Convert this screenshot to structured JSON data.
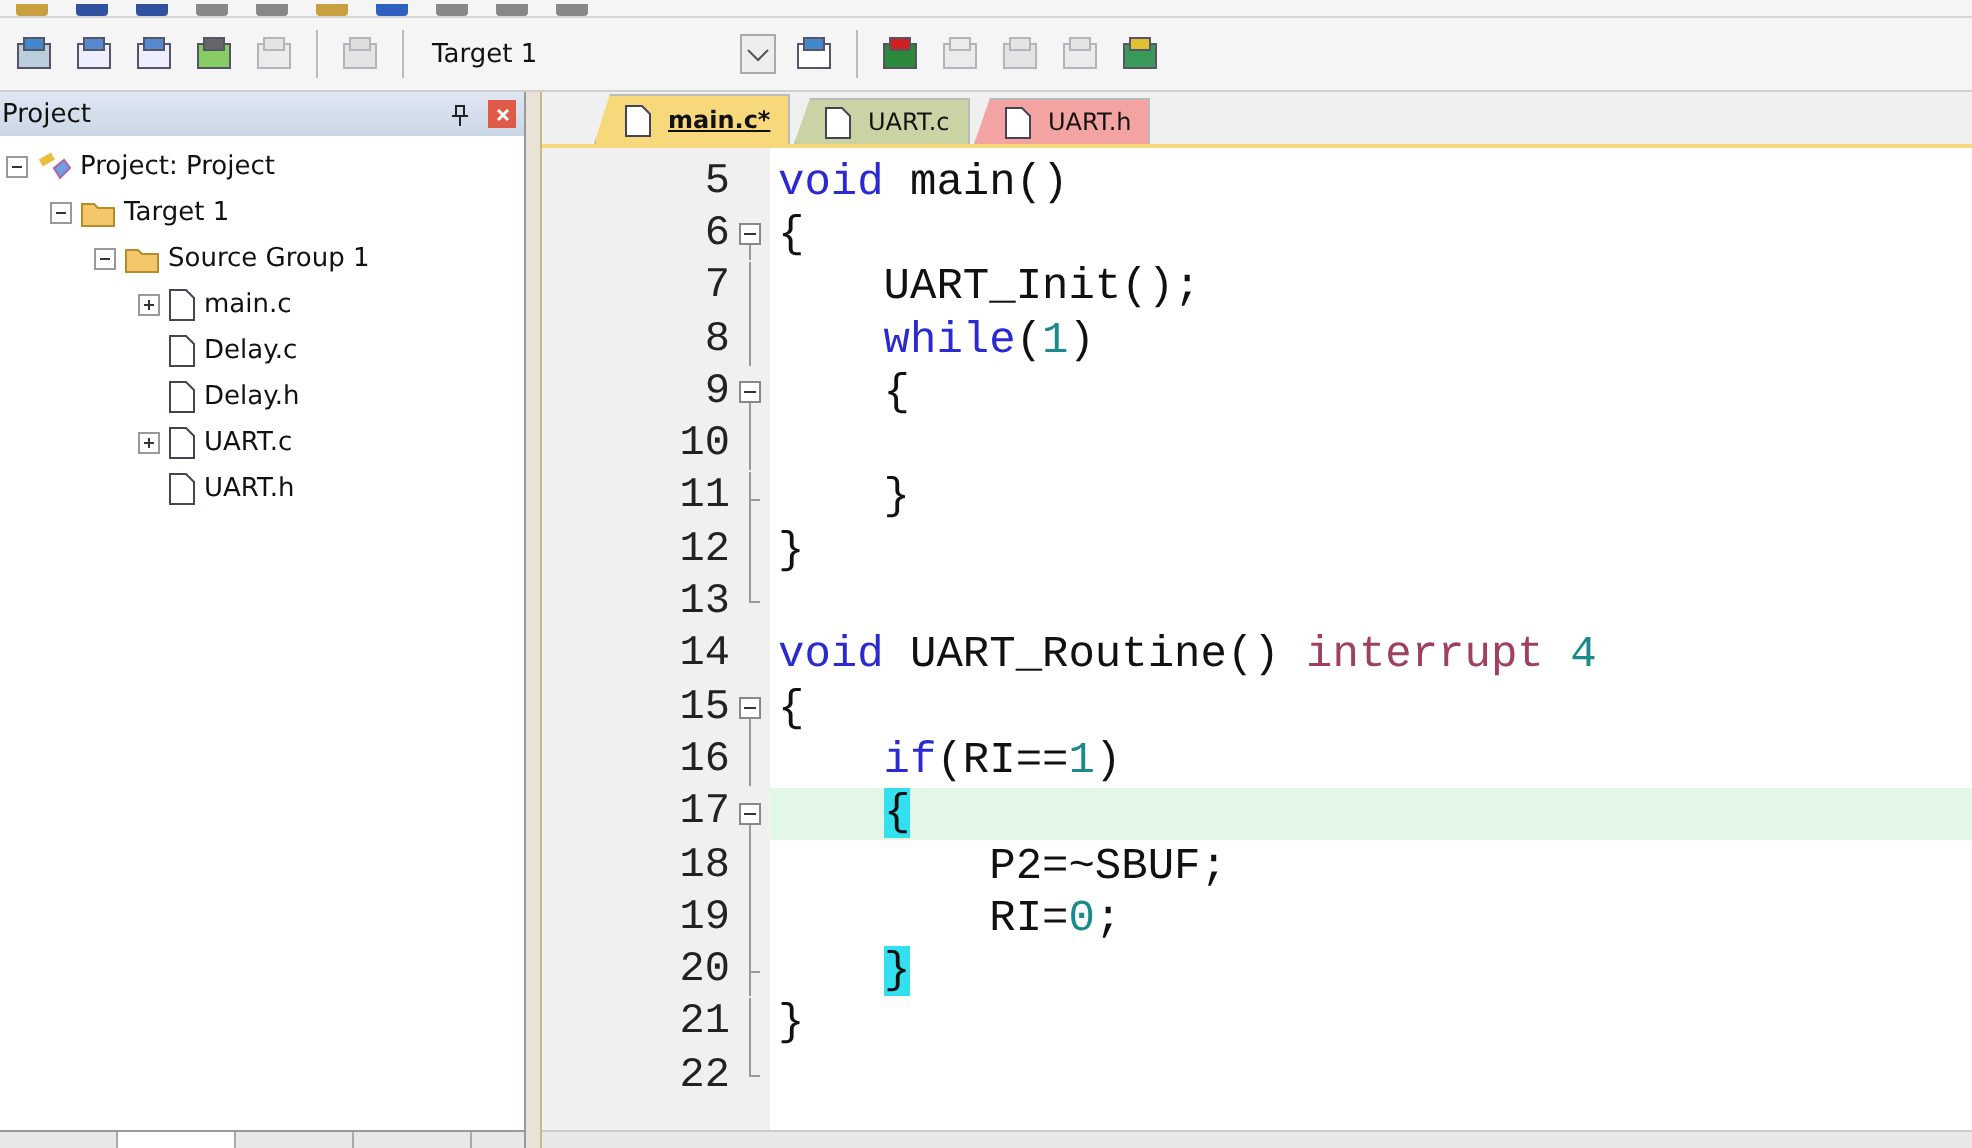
{
  "toolbar": {
    "target": "Target 1"
  },
  "project_panel": {
    "title": "Project",
    "tree": [
      {
        "label": "Project: Project",
        "kind": "project",
        "expanded": true,
        "children": [
          {
            "label": "Target 1",
            "kind": "target",
            "expanded": true,
            "children": [
              {
                "label": "Source Group 1",
                "kind": "group",
                "expanded": true,
                "children": [
                  {
                    "label": "main.c",
                    "kind": "file",
                    "expanded": false
                  },
                  {
                    "label": "Delay.c",
                    "kind": "file"
                  },
                  {
                    "label": "Delay.h",
                    "kind": "file"
                  },
                  {
                    "label": "UART.c",
                    "kind": "file",
                    "expanded": false
                  },
                  {
                    "label": "UART.h",
                    "kind": "file"
                  }
                ]
              }
            ]
          }
        ]
      }
    ]
  },
  "editor": {
    "tabs": [
      {
        "label": "main.c*",
        "selected": true,
        "color": "#f7d97c"
      },
      {
        "label": "UART.c",
        "selected": false,
        "color": "#c9d3a4"
      },
      {
        "label": "UART.h",
        "selected": false,
        "color": "#f4a3a3"
      }
    ],
    "lines": [
      {
        "number": "5",
        "kind": "plain",
        "highlighted": false,
        "tokens": [
          {
            "kind": "keyword",
            "text": "void"
          },
          {
            "kind": "plain",
            "text": " main()"
          }
        ]
      },
      {
        "number": "6",
        "kind": "fold",
        "highlighted": false,
        "tokens": [
          {
            "kind": "plain",
            "text": "{"
          }
        ]
      },
      {
        "number": "7",
        "kind": "body",
        "highlighted": false,
        "tokens": [
          {
            "kind": "plain",
            "text": "    UART_Init();"
          }
        ]
      },
      {
        "number": "8",
        "kind": "body",
        "highlighted": false,
        "tokens": [
          {
            "kind": "keyword",
            "text": "    while"
          },
          {
            "kind": "plain",
            "text": "("
          },
          {
            "kind": "number",
            "text": "1"
          },
          {
            "kind": "plain",
            "text": ")"
          }
        ]
      },
      {
        "number": "9",
        "kind": "fold",
        "highlighted": false,
        "tokens": [
          {
            "kind": "plain",
            "text": "    {"
          }
        ]
      },
      {
        "number": "10",
        "kind": "body",
        "highlighted": false
      },
      {
        "number": "11",
        "kind": "tick",
        "highlighted": false,
        "tokens": [
          {
            "kind": "plain",
            "text": "    }"
          }
        ]
      },
      {
        "number": "12",
        "kind": "body",
        "highlighted": false,
        "tokens": [
          {
            "kind": "plain",
            "text": "}"
          }
        ]
      },
      {
        "number": "13",
        "kind": "end",
        "highlighted": false
      },
      {
        "number": "14",
        "kind": "plain",
        "highlighted": false,
        "tokens": [
          {
            "kind": "keyword",
            "text": "void"
          },
          {
            "kind": "plain",
            "text": " UART_Routine() "
          },
          {
            "kind": "modifier",
            "text": "interrupt"
          },
          {
            "kind": "number",
            "text": " 4"
          }
        ]
      },
      {
        "number": "15",
        "kind": "fold",
        "highlighted": false,
        "tokens": [
          {
            "kind": "plain",
            "text": "{"
          }
        ]
      },
      {
        "number": "16",
        "kind": "body",
        "highlighted": false,
        "tokens": [
          {
            "kind": "keyword",
            "text": "    if"
          },
          {
            "kind": "plain",
            "text": "(RI=="
          },
          {
            "kind": "number",
            "text": "1"
          },
          {
            "kind": "plain",
            "text": ")"
          }
        ]
      },
      {
        "number": "17",
        "kind": "fold",
        "highlighted": true,
        "tokens": [
          {
            "kind": "brace",
            "text": "{"
          }
        ]
      },
      {
        "number": "18",
        "kind": "body",
        "highlighted": false,
        "tokens": [
          {
            "kind": "plain",
            "text": "        P2=~SBUF;"
          }
        ]
      },
      {
        "number": "19",
        "kind": "body",
        "highlighted": false,
        "tokens": [
          {
            "kind": "plain",
            "text": "        RI="
          },
          {
            "kind": "number",
            "text": "0"
          },
          {
            "kind": "plain",
            "text": ";"
          }
        ]
      },
      {
        "number": "20",
        "kind": "tick",
        "highlighted": false,
        "tokens": [
          {
            "kind": "brace",
            "text": "}"
          }
        ]
      },
      {
        "number": "21",
        "kind": "body",
        "highlighted": false,
        "tokens": [
          {
            "kind": "plain",
            "text": "}"
          }
        ]
      },
      {
        "number": "22",
        "kind": "end",
        "highlighted": false
      }
    ]
  }
}
